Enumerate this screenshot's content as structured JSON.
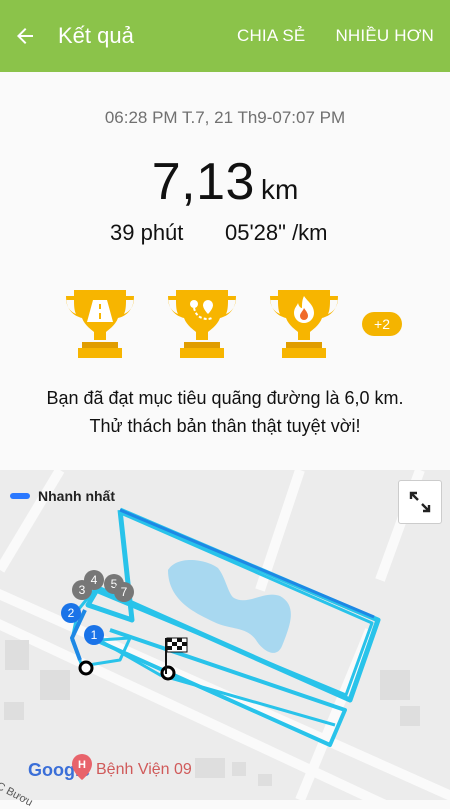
{
  "appbar": {
    "title": "Kết quả",
    "share_label": "CHIA SẺ",
    "more_label": "NHIỀU HƠN"
  },
  "workout": {
    "time_range": "06:28 PM T.7, 21 Th9-07:07 PM",
    "distance_value": "7,13",
    "distance_unit": "km",
    "duration": "39 phút",
    "pace": "05'28\" /km"
  },
  "achievements": {
    "trophies": [
      "road-trophy-icon",
      "route-trophy-icon",
      "fire-trophy-icon"
    ],
    "extra_count": "+2",
    "message_line1": "Bạn đã đạt mục tiêu quãng đường là 6,0 km.",
    "message_line2": "Thử thách bản thân thật tuyệt vời!"
  },
  "map": {
    "legend_label": "Nhanh nhất",
    "markers": [
      "1",
      "2",
      "3",
      "4",
      "5",
      "7"
    ],
    "google_label": "Google",
    "poi_label": "Bệnh Viện 09",
    "street_label": "C Bươu",
    "colors": {
      "track": "#29c3ea",
      "fastest": "#2a78ff",
      "water": "#a8d8f0"
    }
  }
}
